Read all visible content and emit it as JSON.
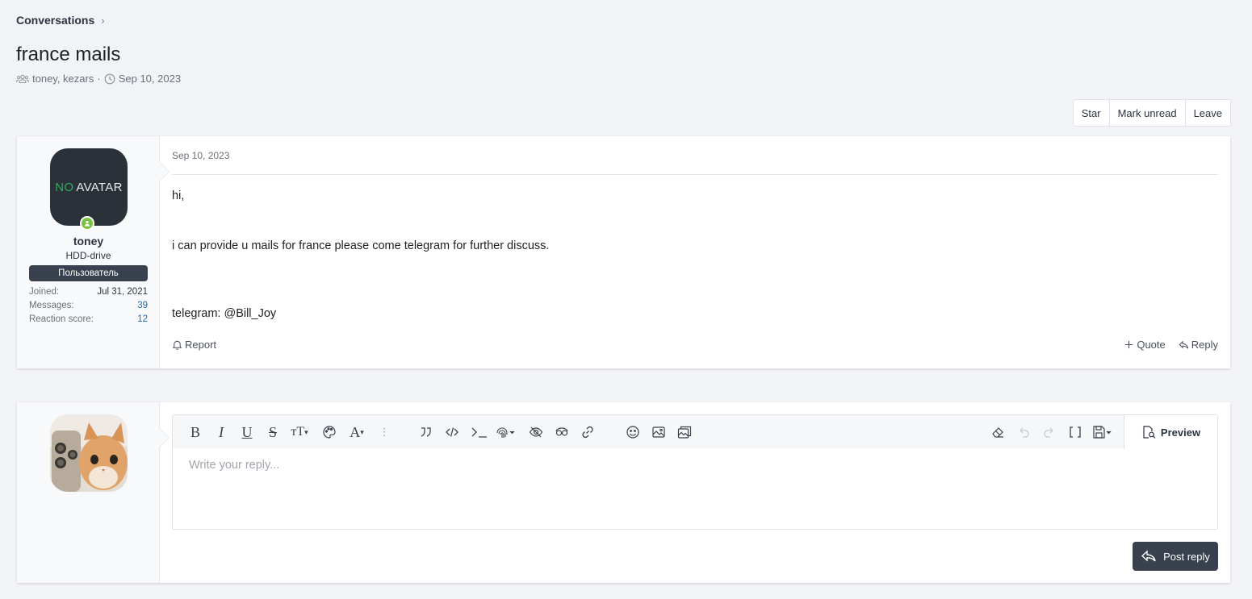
{
  "breadcrumb": {
    "label": "Conversations",
    "chevron": "›"
  },
  "title": "france mails",
  "meta": {
    "participants": "toney, kezars",
    "separator": "·",
    "date": "Sep 10, 2023"
  },
  "actions": {
    "star": "Star",
    "mark_unread": "Mark unread",
    "leave": "Leave"
  },
  "message": {
    "author": {
      "avatar_no": "NO",
      "avatar_word": "AVATAR",
      "name": "toney",
      "title": "HDD-drive",
      "banner": "Пользователь",
      "stats": [
        {
          "label": "Joined:",
          "value": "Jul 31, 2021"
        },
        {
          "label": "Messages:",
          "value": "39"
        },
        {
          "label": "Reaction score:",
          "value": "12"
        }
      ]
    },
    "date": "Sep 10, 2023",
    "lines": [
      "hi,",
      "i can provide u mails for france please come telegram for further discuss.",
      "telegram: @Bill_Joy"
    ],
    "report": "Report",
    "quote": "Quote",
    "reply": "Reply"
  },
  "reply_box": {
    "placeholder": "Write your reply...",
    "preview": "Preview",
    "post": "Post reply",
    "toolbar_glyphs": {
      "bold": "B",
      "italic": "I",
      "underline": "U",
      "strike": "S",
      "size": "тT",
      "font": "A",
      "more": "⋮"
    }
  },
  "colors": {
    "accent_dark": "#38414d",
    "online": "#7cc142",
    "brand_green": "#2fae54",
    "link": "#2468b6"
  }
}
